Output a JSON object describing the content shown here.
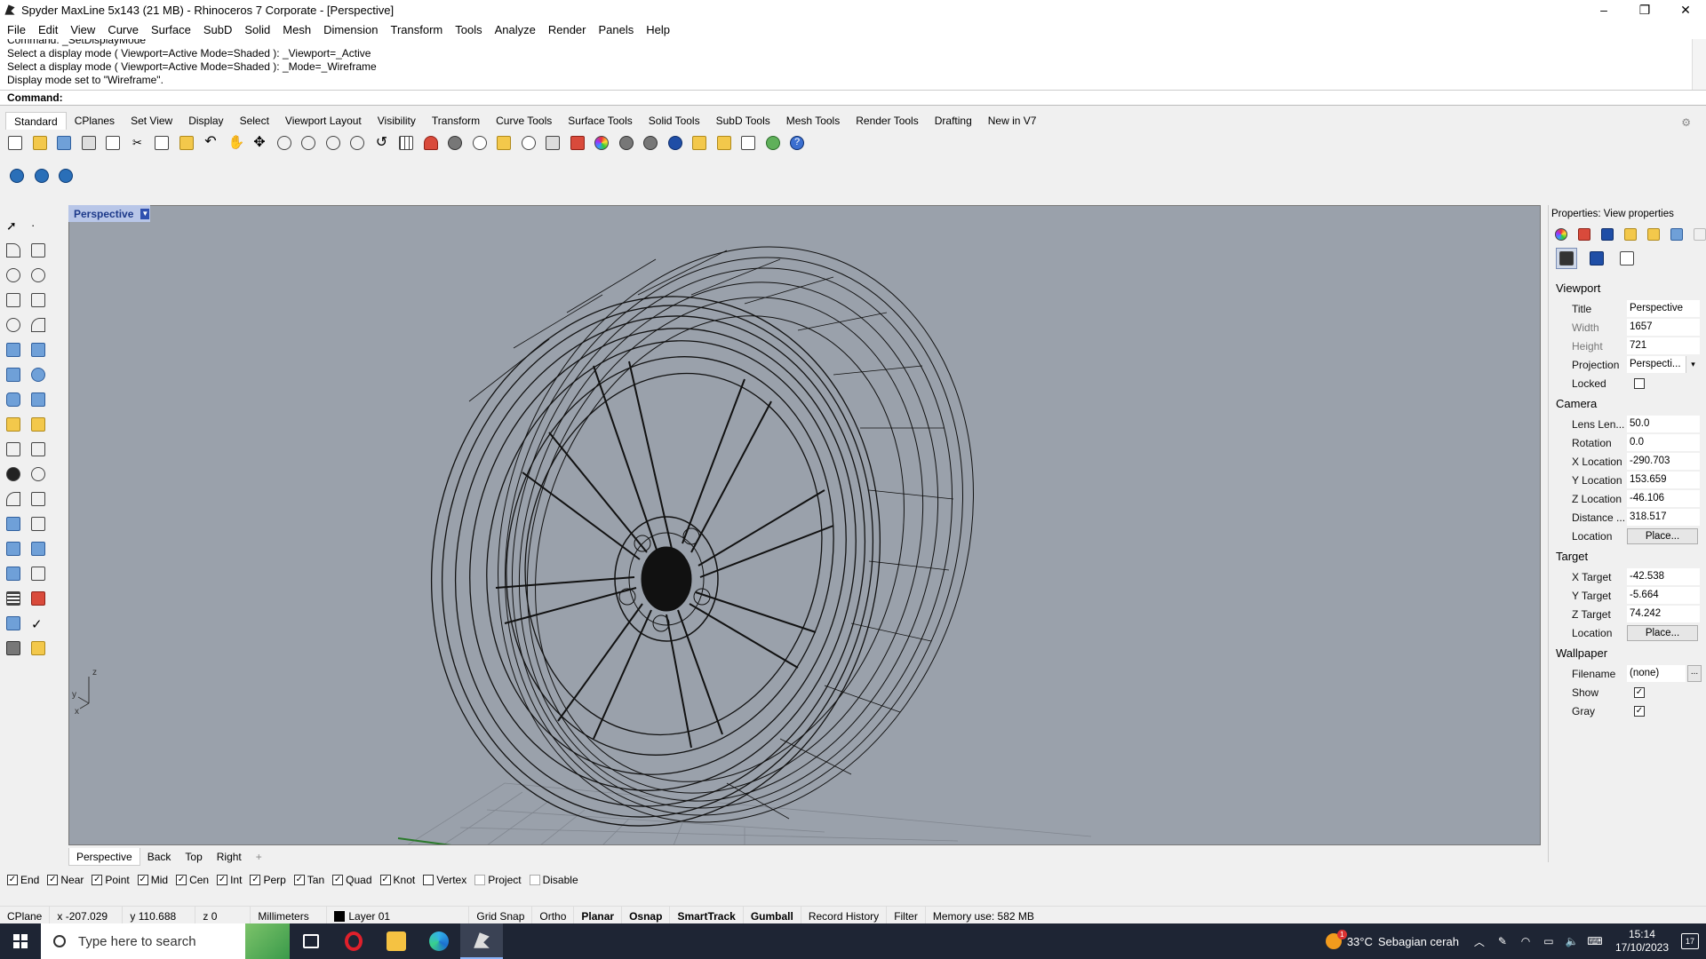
{
  "window": {
    "title": "Spyder MaxLine 5x143 (21 MB) - Rhinoceros 7 Corporate - [Perspective]",
    "controls": [
      "–",
      "❐",
      "✕"
    ]
  },
  "menu": [
    "File",
    "Edit",
    "View",
    "Curve",
    "Surface",
    "SubD",
    "Solid",
    "Mesh",
    "Dimension",
    "Transform",
    "Tools",
    "Analyze",
    "Render",
    "Panels",
    "Help"
  ],
  "command_history": [
    "Command: _SetDisplayMode",
    "Select a display mode ( Viewport=Active  Mode=Shaded ): _Viewport=_Active",
    "Select a display mode ( Viewport=Active  Mode=Shaded ): _Mode=_Wireframe",
    "Display mode set to \"Wireframe\"."
  ],
  "command_prompt": "Command:",
  "toolbar_tabs": [
    "Standard",
    "CPlanes",
    "Set View",
    "Display",
    "Select",
    "Viewport Layout",
    "Visibility",
    "Transform",
    "Curve Tools",
    "Surface Tools",
    "Solid Tools",
    "SubD Tools",
    "Mesh Tools",
    "Render Tools",
    "Drafting",
    "New in V7"
  ],
  "active_tab": "Standard",
  "viewport": {
    "label": "Perspective",
    "axis_z": "z",
    "axis_y": "y",
    "axis_x": "x",
    "display_mode": "Wireframe"
  },
  "viewport_tabs": [
    "Perspective",
    "Back",
    "Top",
    "Right",
    "+"
  ],
  "osnaps": [
    {
      "label": "End",
      "checked": true
    },
    {
      "label": "Near",
      "checked": true
    },
    {
      "label": "Point",
      "checked": true
    },
    {
      "label": "Mid",
      "checked": true
    },
    {
      "label": "Cen",
      "checked": true
    },
    {
      "label": "Int",
      "checked": true
    },
    {
      "label": "Perp",
      "checked": true
    },
    {
      "label": "Tan",
      "checked": true
    },
    {
      "label": "Quad",
      "checked": true
    },
    {
      "label": "Knot",
      "checked": true
    },
    {
      "label": "Vertex",
      "checked": false
    },
    {
      "label": "Project",
      "checked": false
    },
    {
      "label": "Disable",
      "checked": false
    }
  ],
  "status": {
    "cplane": "CPlane",
    "x": "x -207.029",
    "y": "y 110.688",
    "z": "z 0",
    "units": "Millimeters",
    "layer": "Layer 01",
    "grid_snap": "Grid Snap",
    "ortho": "Ortho",
    "planar": "Planar",
    "osnap": "Osnap",
    "smarttrack": "SmartTrack",
    "gumball": "Gumball",
    "record_history": "Record History",
    "filter": "Filter",
    "memory": "Memory use: 582 MB"
  },
  "properties": {
    "header": "Properties: View properties",
    "viewport": {
      "section": "Viewport",
      "title_label": "Title",
      "title": "Perspective",
      "width_label": "Width",
      "width": "1657",
      "height_label": "Height",
      "height": "721",
      "projection_label": "Projection",
      "projection": "Perspecti...",
      "locked_label": "Locked"
    },
    "camera": {
      "section": "Camera",
      "lens_label": "Lens Len...",
      "lens": "50.0",
      "rotation_label": "Rotation",
      "rotation": "0.0",
      "xloc_label": "X Location",
      "xloc": "-290.703",
      "yloc_label": "Y Location",
      "yloc": "153.659",
      "zloc_label": "Z Location",
      "zloc": "-46.106",
      "distance_label": "Distance ...",
      "distance": "318.517",
      "location_label": "Location",
      "place": "Place..."
    },
    "target": {
      "section": "Target",
      "x_label": "X Target",
      "x": "-42.538",
      "y_label": "Y Target",
      "y": "-5.664",
      "z_label": "Z Target",
      "z": "74.242",
      "location_label": "Location",
      "place": "Place..."
    },
    "wallpaper": {
      "section": "Wallpaper",
      "filename_label": "Filename",
      "filename": "(none)",
      "browse": "...",
      "show_label": "Show",
      "gray_label": "Gray"
    }
  },
  "taskbar": {
    "search_placeholder": "Type here to search",
    "temperature": "33°C",
    "weather": "Sebagian cerah",
    "time": "15:14",
    "date": "17/10/2023",
    "weather_badge": "1",
    "notif_count": "17"
  },
  "colors": {
    "viewport_bg": "#9aa1ab",
    "wire": "#111111",
    "taskbar": "#1e2534",
    "accent": "#1d3a8a"
  }
}
